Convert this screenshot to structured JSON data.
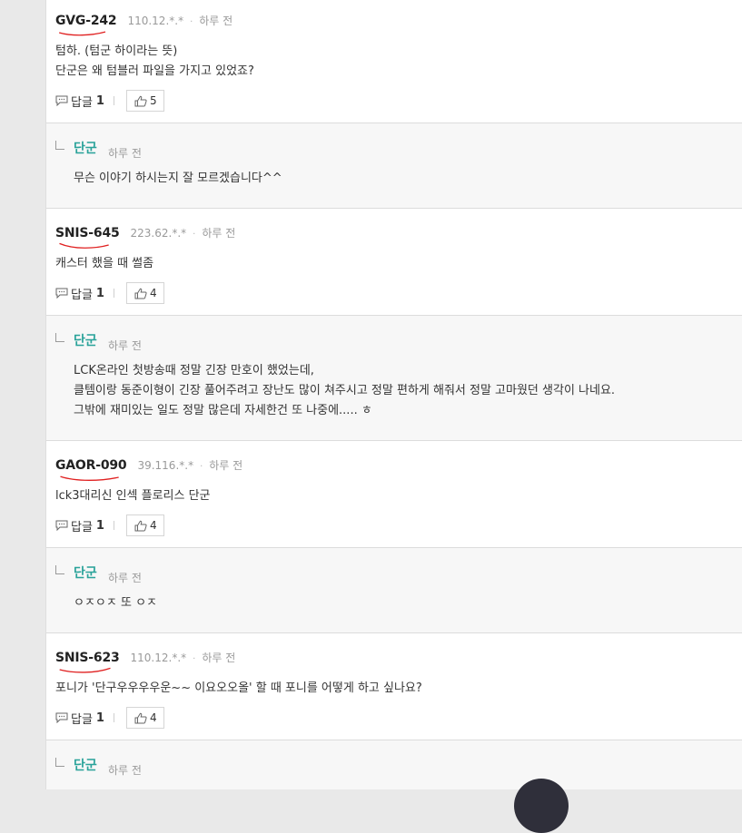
{
  "colors": {
    "page_bg": "#e9e9e9",
    "panel_bg": "#ffffff",
    "reply_bg": "#f7f7f7",
    "author_color": "#2aa39a",
    "underline_color": "#e02020"
  },
  "icons": {
    "reply": "speech-bubble-icon",
    "like": "thumbs-up-icon",
    "reply_arrow": "reply-corner-icon"
  },
  "comments": [
    {
      "nick": "GVG-242",
      "ip": "110.12.*.*",
      "time": "하루 전",
      "lines": [
        "텀하. (텀군 하이라는 뜻)",
        "단군은 왜 텀블러 파일을 가지고 있었죠?"
      ],
      "reply_label": "답글",
      "reply_count": "1",
      "likes": "5",
      "reply": {
        "author": "단군",
        "time": "하루 전",
        "lines": [
          "무슨 이야기 하시는지 잘 모르겠습니다^^"
        ]
      }
    },
    {
      "nick": "SNIS-645",
      "ip": "223.62.*.*",
      "time": "하루 전",
      "lines": [
        "캐스터 했을 때 썰좀"
      ],
      "reply_label": "답글",
      "reply_count": "1",
      "likes": "4",
      "reply": {
        "author": "단군",
        "time": "하루 전",
        "lines": [
          "LCK온라인 첫방송때 정말 긴장 만호이 했었는데,",
          "클템이랑 동준이형이 긴장 풀어주려고 장난도 많이 쳐주시고 정말 편하게 해줘서 정말 고마웠던 생각이 나네요.",
          "그밖에 재미있는 일도 정말 많은데 자세한건 또 나중에..... ㅎ"
        ]
      }
    },
    {
      "nick": "GAOR-090",
      "ip": "39.116.*.*",
      "time": "하루 전",
      "lines": [
        "lck3대리신 인섹 플로리스 단군"
      ],
      "reply_label": "답글",
      "reply_count": "1",
      "likes": "4",
      "reply": {
        "author": "단군",
        "time": "하루 전",
        "lines": [
          "ㅇㅈㅇㅈ 또 ㅇㅈ"
        ]
      }
    },
    {
      "nick": "SNIS-623",
      "ip": "110.12.*.*",
      "time": "하루 전",
      "lines": [
        "포니가 '단구우우우우운~~ 이요오오올' 할 때 포니를 어떻게 하고 싶나요?"
      ],
      "reply_label": "답글",
      "reply_count": "1",
      "likes": "4",
      "reply": {
        "author": "단군",
        "time": "하루 전",
        "lines": []
      }
    }
  ]
}
